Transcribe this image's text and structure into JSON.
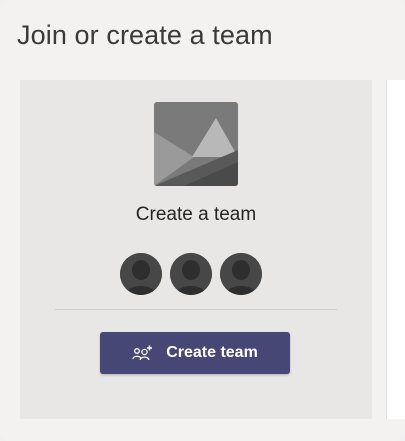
{
  "page": {
    "title": "Join or create a team"
  },
  "create_card": {
    "title": "Create a team",
    "button_label": "Create team",
    "button_icon": "add-people-icon",
    "image_icon": "team-placeholder-image",
    "avatar_icon": "person-avatar-icon",
    "avatar_count": 3
  },
  "colors": {
    "background": "#f3f2f1",
    "card": "#e8e7e6",
    "button": "#464775",
    "button_text": "#ffffff",
    "title_text": "#252423"
  }
}
